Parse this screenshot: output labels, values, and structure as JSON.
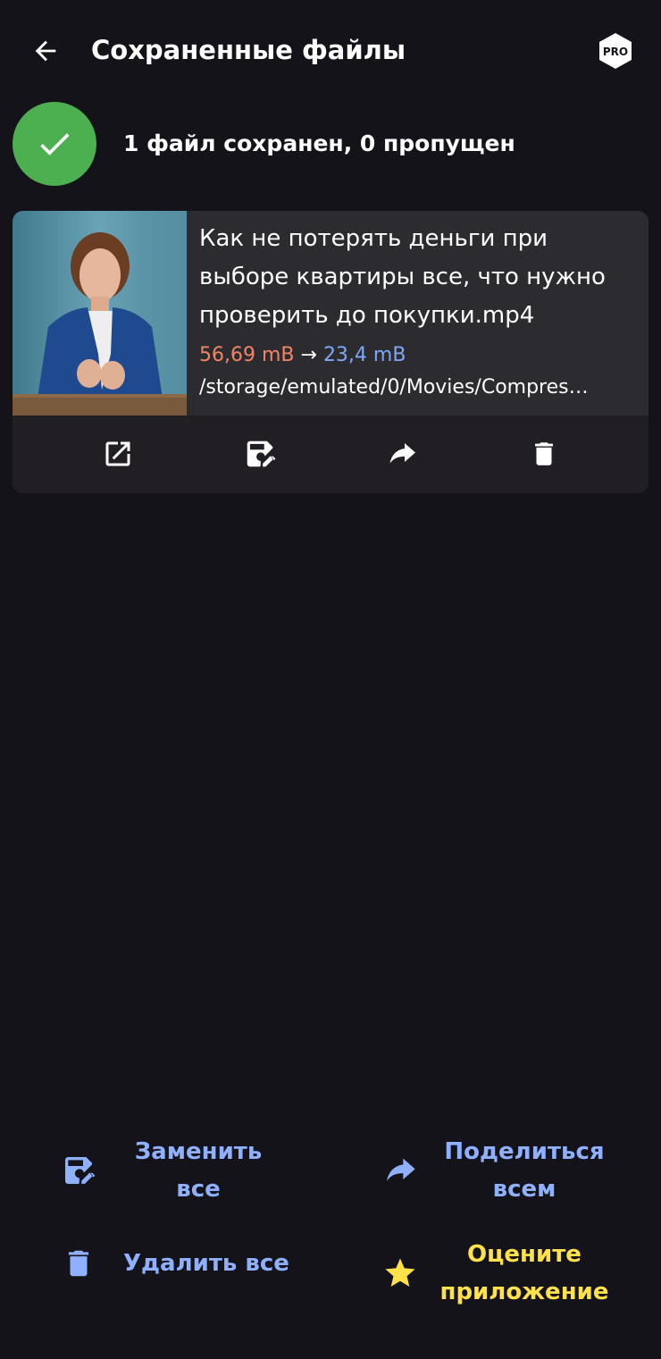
{
  "header": {
    "title": "Сохраненные файлы",
    "back_icon": "arrow-left-icon",
    "pro_badge": "PRO"
  },
  "status": {
    "text": "1 файл сохранен, 0 пропущен",
    "icon": "check-icon",
    "color": "#4caf50"
  },
  "file": {
    "title": "Как не потерять деньги при выборе квартиры все, что нужно проверить до покупки.mp4",
    "size_from": "56,69 mB",
    "arrow": "→",
    "size_to": "23,4 mB",
    "path": "/storage/emulated/0/Movies/Compres…",
    "actions": [
      "open-external-icon",
      "save-edit-icon",
      "share-icon",
      "delete-icon"
    ]
  },
  "bottom_actions": {
    "replace_all": "Заменить все",
    "share_all": "Поделиться всем",
    "delete_all": "Удалить все",
    "rate_app": "Оцените приложение"
  },
  "colors": {
    "background": "#15131a",
    "card": "#2c2b30",
    "size_from": "#f48466",
    "size_to": "#7ea8f7",
    "accent_blue": "#8fb0ff",
    "accent_yellow": "#ffe14a"
  }
}
